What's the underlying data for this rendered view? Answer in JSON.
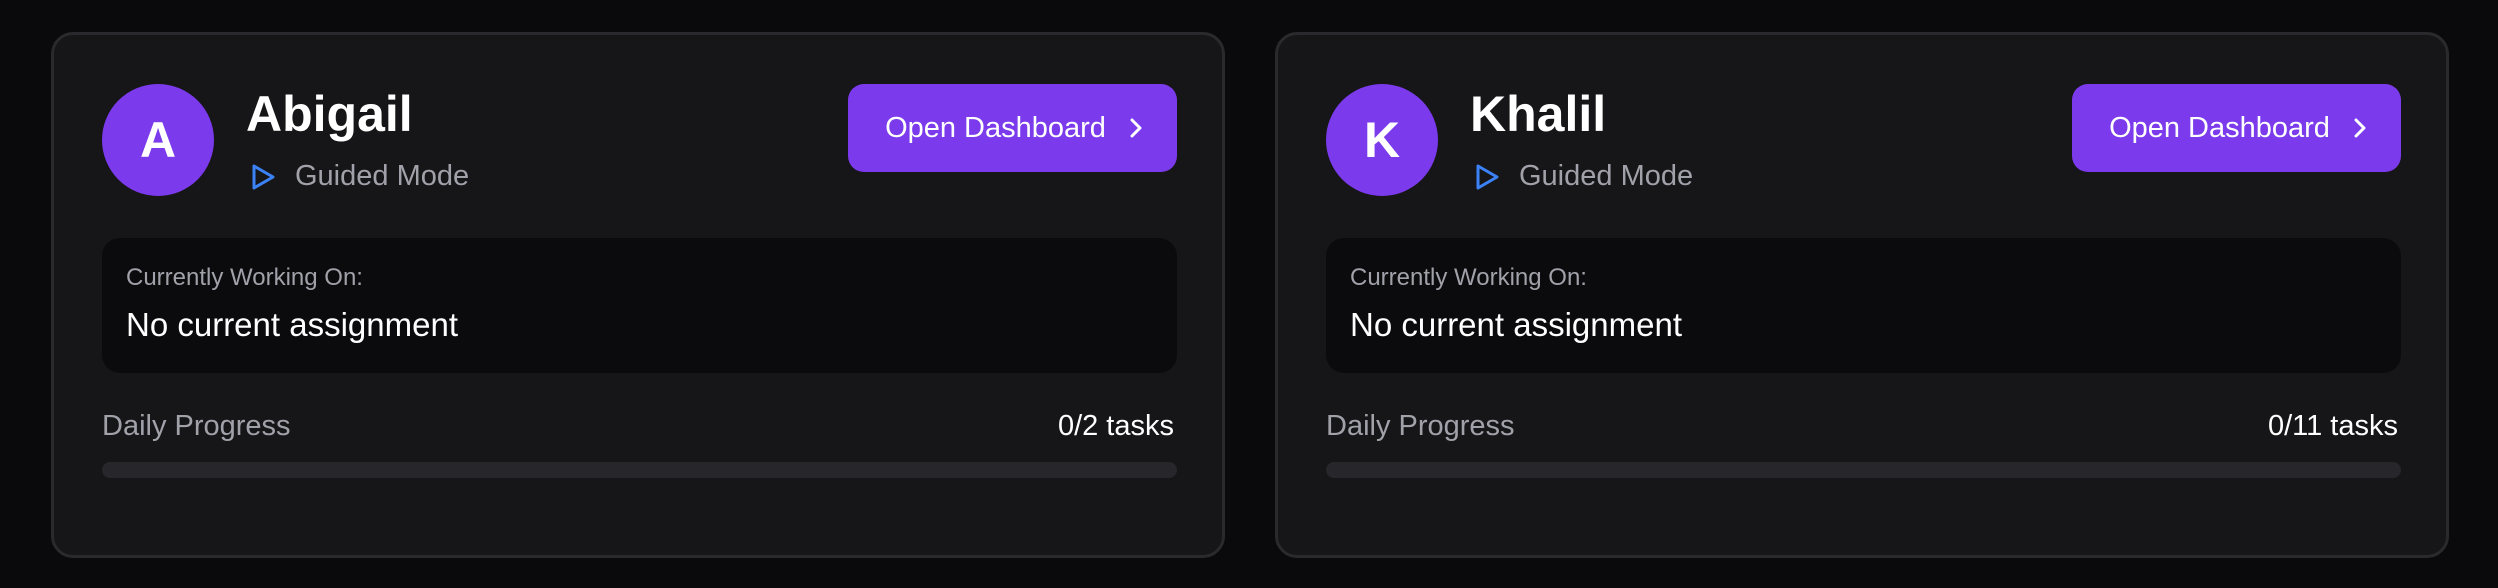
{
  "colors": {
    "accent": "#7c3aed",
    "play_icon": "#3b82f6",
    "card_bg": "#161618"
  },
  "cards": [
    {
      "initial": "A",
      "name": "Abigail",
      "mode": "Guided Mode",
      "mode_icon": "play-icon",
      "button_label": "Open Dashboard",
      "button_icon": "chevron-right-icon",
      "working_label": "Currently Working On:",
      "working_value": "No current assignment",
      "progress_label": "Daily Progress",
      "progress_text": "0/2 tasks",
      "progress_fraction": 0
    },
    {
      "initial": "K",
      "name": "Khalil",
      "mode": "Guided Mode",
      "mode_icon": "play-icon",
      "button_label": "Open Dashboard",
      "button_icon": "chevron-right-icon",
      "working_label": "Currently Working On:",
      "working_value": "No current assignment",
      "progress_label": "Daily Progress",
      "progress_text": "0/11 tasks",
      "progress_fraction": 0
    }
  ]
}
